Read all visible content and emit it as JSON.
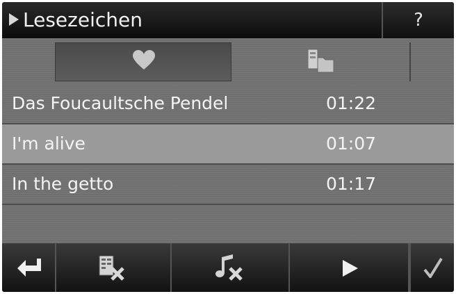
{
  "header": {
    "title": "Lesezeichen",
    "help_label": "?"
  },
  "tabs": [
    {
      "icon": "heart-icon",
      "selected": true
    },
    {
      "icon": "folder-icon",
      "selected": false
    }
  ],
  "list": {
    "items": [
      {
        "title": "Das Foucaultsche Pendel",
        "duration": "01:22",
        "selected": false
      },
      {
        "title": "I'm alive",
        "duration": "01:07",
        "selected": true
      },
      {
        "title": "In the getto",
        "duration": "01:17",
        "selected": false
      }
    ]
  },
  "toolbar": {
    "buttons": [
      {
        "icon": "back-arrow-icon"
      },
      {
        "icon": "delete-list-icon"
      },
      {
        "icon": "delete-music-icon"
      },
      {
        "icon": "play-icon"
      },
      {
        "icon": "checkmark-icon"
      }
    ]
  }
}
